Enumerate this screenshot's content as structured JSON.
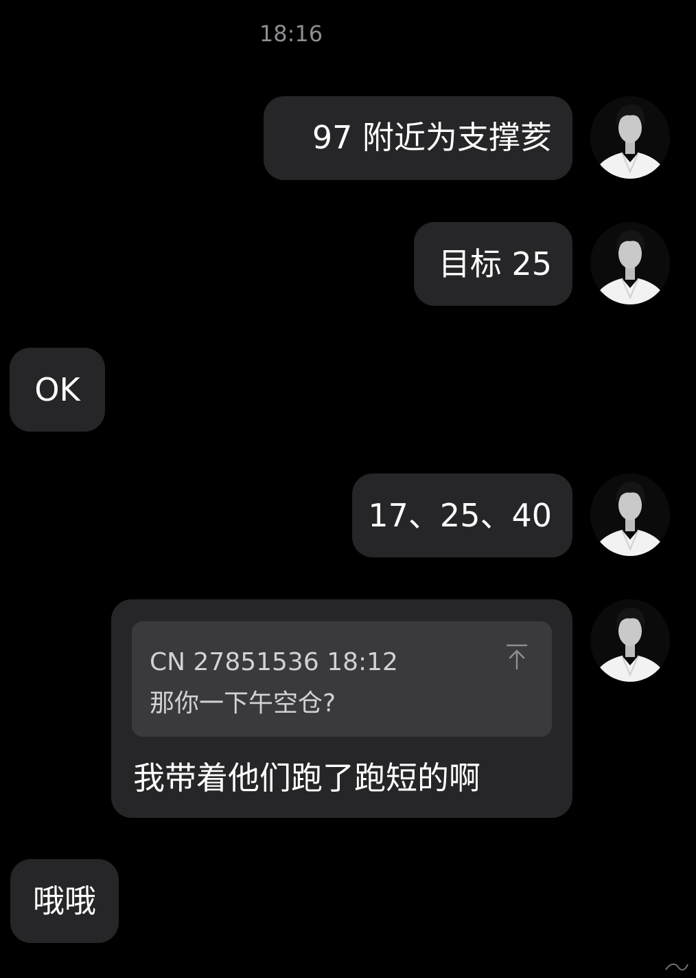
{
  "chat": {
    "timestamp": "18:16",
    "messages": [
      {
        "side": "right",
        "text": "97 附近为支撑荄"
      },
      {
        "side": "right",
        "text": "目标 25"
      },
      {
        "side": "left",
        "text": "OK"
      },
      {
        "side": "right",
        "text": "17、25、40"
      },
      {
        "side": "right",
        "quote": {
          "meta": "CN 27851536 18:12",
          "text": "那你一下午空仓?"
        },
        "text": "我带着他们跑了跑短的啊"
      },
      {
        "side": "left",
        "text": "哦哦"
      }
    ]
  },
  "icons": {
    "quote_jump": "arrow-up-to-top-icon",
    "avatar": "user-avatar-photo"
  },
  "colors": {
    "background": "#000000",
    "bubble": "#262628",
    "quote_box": "#3a3a3c",
    "timestamp": "#8e8e93"
  }
}
